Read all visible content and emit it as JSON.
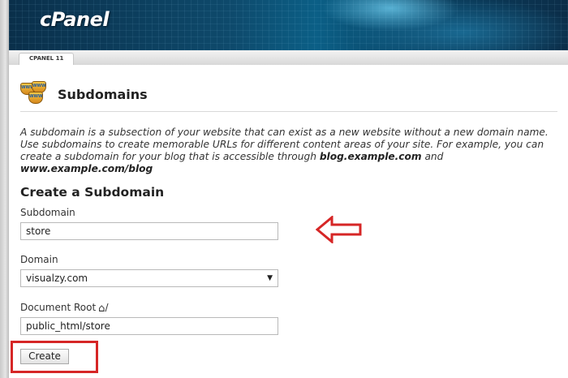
{
  "app": {
    "name": "cPanel",
    "version_tab": "CPANEL 11"
  },
  "header": {
    "title": "Subdomains",
    "icon": "subdomain-badges-icon",
    "badge_text": "WWW"
  },
  "description": {
    "part1": "A subdomain is a subsection of your website that can exist as a new website without a new domain name. Use subdomains to create memorable URLs for different content areas of your site. For example, you can create a subdomain for your blog that is accessible through ",
    "example1": "blog.example.com",
    "part2": " and ",
    "example2": "www.example.com/blog"
  },
  "form": {
    "section_title": "Create a Subdomain",
    "subdomain": {
      "label": "Subdomain",
      "value": "store"
    },
    "domain": {
      "label": "Domain",
      "value": "visualzy.com"
    },
    "document_root": {
      "label": "Document Root",
      "suffix": "/",
      "icon": "home-icon",
      "value": "public_html/store"
    },
    "submit_label": "Create"
  },
  "annotations": {
    "color": "#d62626",
    "arrow_icon": "left-arrow-outline",
    "box": "create-button-highlight"
  }
}
